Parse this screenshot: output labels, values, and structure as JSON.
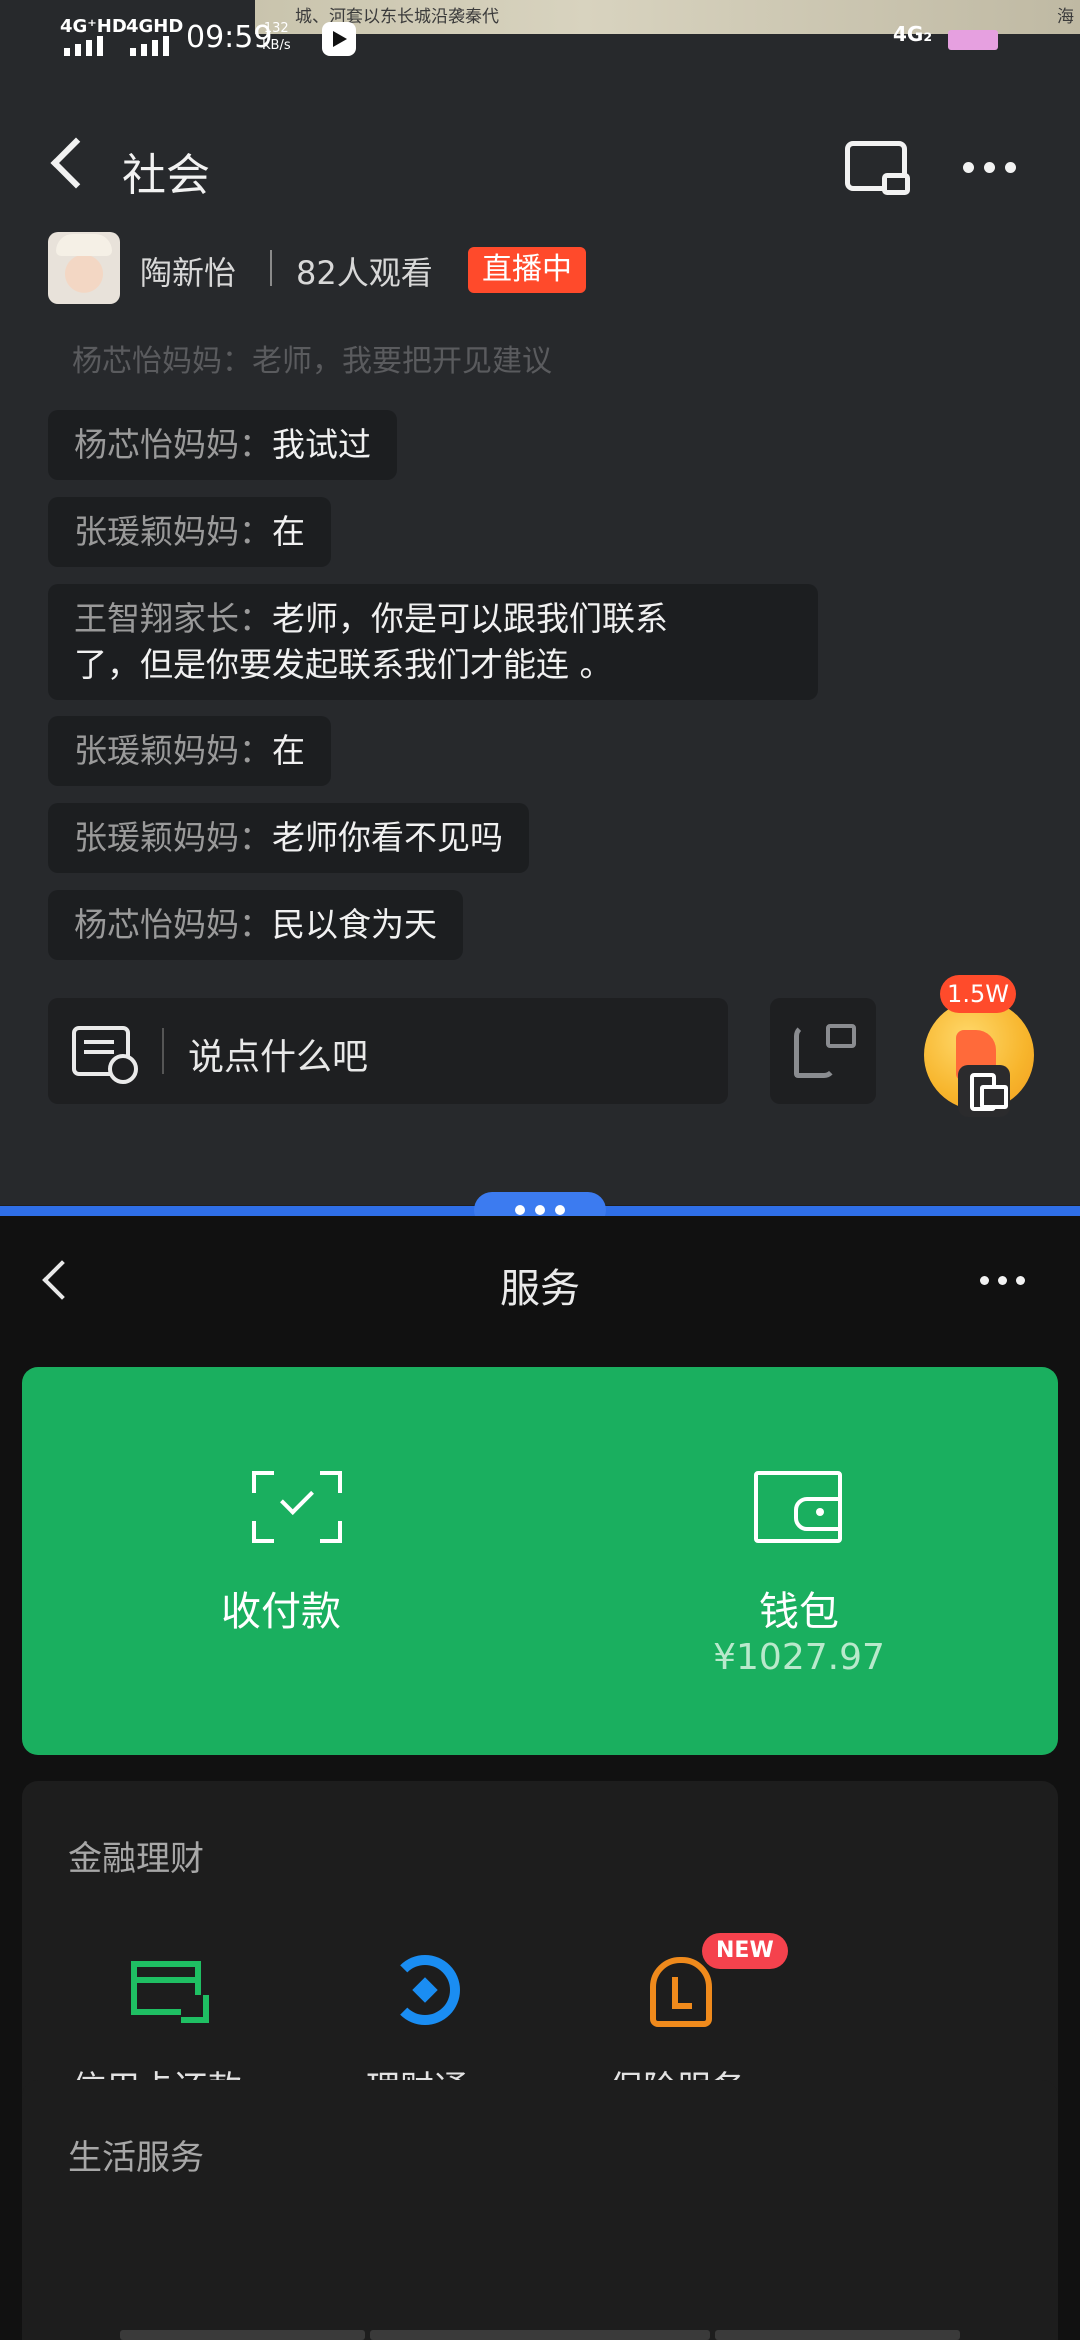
{
  "status_bar": {
    "sim1": "4G⁺HD",
    "sim2": "4GHD",
    "time": "09:59",
    "net_speed_value": "132",
    "net_speed_unit": "KB/s",
    "network_right": "4G₂",
    "map_fragment_left": "城、河套以东长城沿袭秦代",
    "map_fragment_right": "海"
  },
  "live": {
    "nav_title": "社会",
    "host_name": "陶新怡",
    "viewers": "82人观看",
    "live_badge": "直播中",
    "faded_line": "杨芯怡妈妈：老师，我要把开见建议",
    "messages": [
      {
        "user": "杨芯怡妈妈：",
        "text": "我试过"
      },
      {
        "user": "张瑗颖妈妈：",
        "text": "在"
      },
      {
        "user": "王智翔家长：",
        "text": "老师，你是可以跟我们联系",
        "text2": "了，但是你要发起联系我们才能连 。"
      },
      {
        "user": "张瑗颖妈妈：",
        "text": "在"
      },
      {
        "user": "张瑗颖妈妈：",
        "text": "老师你看不见吗"
      },
      {
        "user": "杨芯怡妈妈：",
        "text": "民以食为天"
      }
    ],
    "input_placeholder": "说点什么吧",
    "like_count": "1.5W"
  },
  "services": {
    "nav_title": "服务",
    "pay_card": {
      "collect_label": "收付款",
      "wallet_label": "钱包",
      "wallet_amount": "¥1027.97",
      "accent_color": "#1aaf5f"
    },
    "finance": {
      "section_title": "金融理财",
      "items": [
        {
          "label": "信用卡还款",
          "icon": "credit-card-icon"
        },
        {
          "label": "理财通",
          "icon": "wealth-icon"
        },
        {
          "label": "保险服务",
          "icon": "insurance-icon",
          "badge": "NEW"
        }
      ]
    },
    "life": {
      "section_title": "生活服务"
    }
  }
}
